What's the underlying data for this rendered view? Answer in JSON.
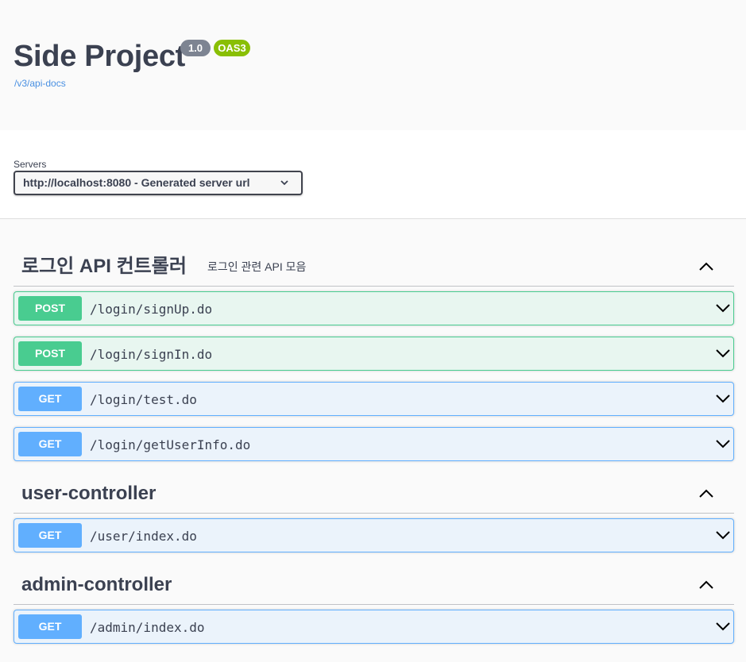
{
  "info": {
    "title": "Side Project",
    "version": "1.0",
    "oas_badge": "OAS3",
    "api_docs_link": "/v3/api-docs"
  },
  "servers": {
    "label": "Servers",
    "selected": "http://localhost:8080 - Generated server url"
  },
  "tags": [
    {
      "name": "로그인 API 컨트롤러",
      "description": "로그인 관련 API 모음",
      "operations": [
        {
          "method": "POST",
          "path": "/login/signUp.do"
        },
        {
          "method": "POST",
          "path": "/login/signIn.do"
        },
        {
          "method": "GET",
          "path": "/login/test.do"
        },
        {
          "method": "GET",
          "path": "/login/getUserInfo.do"
        }
      ]
    },
    {
      "name": "user-controller",
      "description": "",
      "operations": [
        {
          "method": "GET",
          "path": "/user/index.do"
        }
      ]
    },
    {
      "name": "admin-controller",
      "description": "",
      "operations": [
        {
          "method": "GET",
          "path": "/admin/index.do"
        }
      ]
    }
  ],
  "colors": {
    "post": "#49cc90",
    "get": "#61affe",
    "oas_badge": "#89bf04",
    "version_badge": "#7d8492",
    "link": "#4990e2"
  }
}
